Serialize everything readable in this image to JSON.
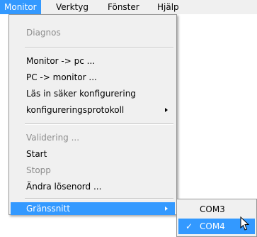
{
  "menubar": {
    "items": [
      {
        "label": "Monitor"
      },
      {
        "label": "Verktyg"
      },
      {
        "label": "Fönster"
      },
      {
        "label": "Hjälp"
      }
    ]
  },
  "monitor_menu": {
    "items": [
      {
        "label": "Diagnos",
        "enabled": false
      },
      {
        "label": "Monitor -> pc ...",
        "enabled": true
      },
      {
        "label": "PC -> monitor ...",
        "enabled": true
      },
      {
        "label": "Läs in säker konfigurering",
        "enabled": true
      },
      {
        "label": "konfigureringsprotokoll",
        "enabled": true,
        "has_submenu": true
      },
      {
        "label": "Validering ...",
        "enabled": false
      },
      {
        "label": "Start",
        "enabled": true
      },
      {
        "label": "Stopp",
        "enabled": false
      },
      {
        "label": "Ändra lösenord ...",
        "enabled": true
      },
      {
        "label": "Gränssnitt",
        "enabled": true,
        "has_submenu": true,
        "highlighted": true
      }
    ]
  },
  "interface_submenu": {
    "items": [
      {
        "label": "COM3",
        "checked": false
      },
      {
        "label": "COM4",
        "checked": true,
        "check_mark": "✓"
      }
    ]
  },
  "colors": {
    "highlight": "#3399ff",
    "menu_bg": "#f0f0f0",
    "disabled_text": "#8d8d8d"
  }
}
